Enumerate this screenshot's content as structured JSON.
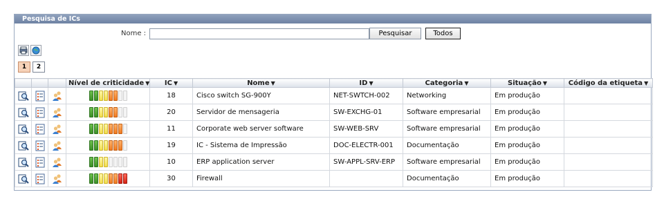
{
  "panel": {
    "title": "Pesquisa de ICs"
  },
  "search": {
    "label": "Nome :",
    "value": "",
    "placeholder": "",
    "search_button": "Pesquisar",
    "all_button": "Todos"
  },
  "toolbar": {
    "icons": [
      "print-icon",
      "export-icon"
    ]
  },
  "pager": {
    "pages": [
      "1",
      "2"
    ],
    "current": "1"
  },
  "table": {
    "headers": {
      "criticality": "Nível de criticidade",
      "ic": "IC",
      "name": "Nome",
      "id": "ID",
      "category": "Categoria",
      "status": "Situação",
      "tag": "Código da etiqueta"
    },
    "sort_arrow": "▼",
    "rows": [
      {
        "criticality": [
          "g",
          "g",
          "y",
          "y",
          "o",
          "o",
          "e",
          "e"
        ],
        "ic": "18",
        "name": "Cisco switch SG-900Y",
        "id": "NET-SWTCH-002",
        "category": "Networking",
        "status": "Em produção",
        "tag": ""
      },
      {
        "criticality": [
          "g",
          "g",
          "y",
          "y",
          "o",
          "o",
          "e",
          "e"
        ],
        "ic": "20",
        "name": "Servidor de mensageria",
        "id": "SW-EXCHG-01",
        "category": "Software empresarial",
        "status": "Em produção",
        "tag": ""
      },
      {
        "criticality": [
          "g",
          "g",
          "y",
          "y",
          "o",
          "o",
          "o",
          "e"
        ],
        "ic": "11",
        "name": "Corporate web server software",
        "id": "SW-WEB-SRV",
        "category": "Software empresarial",
        "status": "Em produção",
        "tag": ""
      },
      {
        "criticality": [
          "g",
          "g",
          "y",
          "y",
          "o",
          "o",
          "o",
          "e"
        ],
        "ic": "19",
        "name": "IC - Sistema de Impressão",
        "id": "DOC-ELECTR-001",
        "category": "Documentação",
        "status": "Em produção",
        "tag": ""
      },
      {
        "criticality": [
          "g",
          "g",
          "y",
          "y",
          "e",
          "e",
          "e",
          "e"
        ],
        "ic": "10",
        "name": "ERP application server",
        "id": "SW-APPL-SRV-ERP",
        "category": "Software empresarial",
        "status": "Em produção",
        "tag": ""
      },
      {
        "criticality": [
          "g",
          "g",
          "y",
          "y",
          "o",
          "o",
          "r",
          "r"
        ],
        "ic": "30",
        "name": "Firewall",
        "id": "",
        "category": "Documentação",
        "status": "Em produção",
        "tag": ""
      }
    ]
  },
  "colors": {
    "header_bg": "#7587a6",
    "active_page": "#f6d2b8"
  }
}
